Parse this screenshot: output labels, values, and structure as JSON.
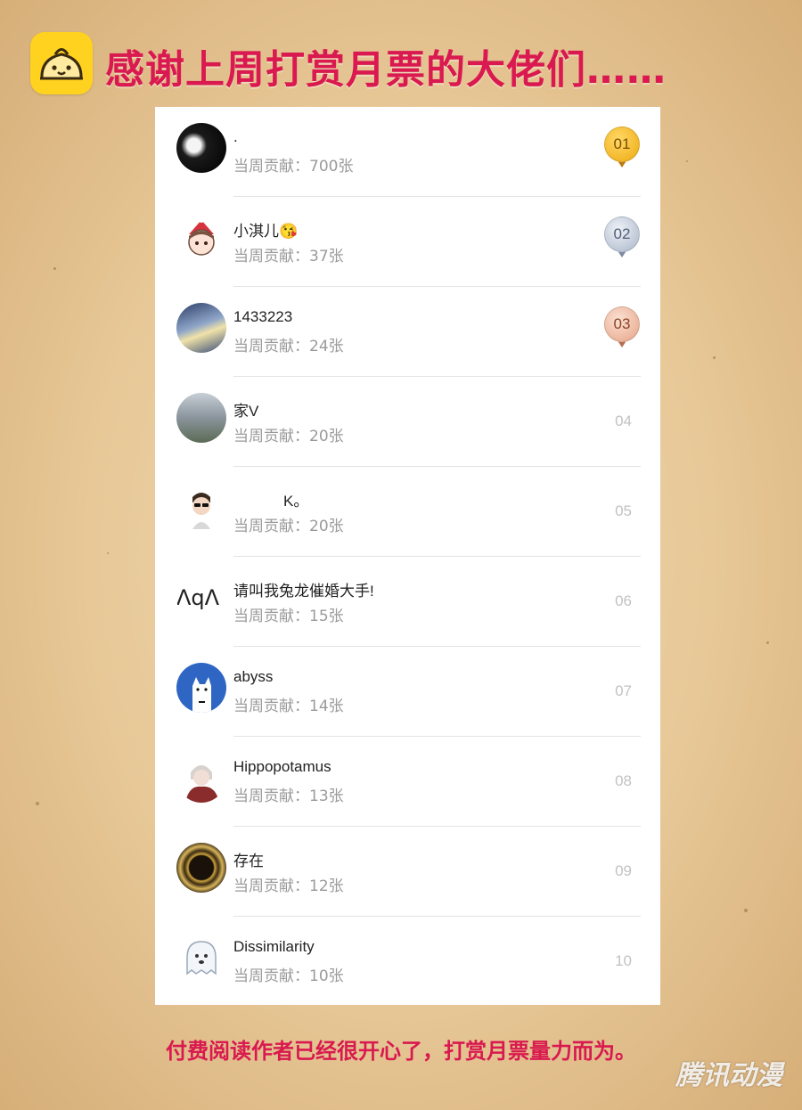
{
  "header": {
    "logo_icon": "bun-mascot-icon",
    "title": "感谢上周打赏月票的大佬们……"
  },
  "list": {
    "amount_prefix": "当周贡献：",
    "rows": [
      {
        "name": ".",
        "amount": "当周贡献：700张",
        "rank": "01",
        "medal": "gold"
      },
      {
        "name": "小淇儿😘",
        "amount": "当周贡献：37张",
        "rank": "02",
        "medal": "silver"
      },
      {
        "name": "1433223",
        "amount": "当周贡献：24张",
        "rank": "03",
        "medal": "bronze"
      },
      {
        "name": "家V",
        "amount": "当周贡献：20张",
        "rank": "04",
        "medal": ""
      },
      {
        "name": "K。",
        "amount": "当周贡献：20张",
        "rank": "05",
        "medal": ""
      },
      {
        "name": "请叫我兔龙催婚大手!",
        "amount": "当周贡献：15张",
        "rank": "06",
        "medal": ""
      },
      {
        "name": "abyss",
        "amount": "当周贡献：14张",
        "rank": "07",
        "medal": ""
      },
      {
        "name": "Hippopotamus",
        "amount": "当周贡献：13张",
        "rank": "08",
        "medal": ""
      },
      {
        "name": "存在",
        "amount": "当周贡献：12张",
        "rank": "09",
        "medal": ""
      },
      {
        "name": "Dissimilarity",
        "amount": "当周贡献：10张",
        "rank": "10",
        "medal": ""
      }
    ],
    "avatar_6_text": "ΛqΛ"
  },
  "footer": {
    "text": "付费阅读作者已经很开心了，打赏月票量力而为。"
  },
  "watermark": {
    "text": "腾讯动漫"
  },
  "colors": {
    "accent": "#d9194f",
    "gold": "#f2b51c",
    "silver": "#a9b6c9",
    "bronze": "#e6a487"
  }
}
